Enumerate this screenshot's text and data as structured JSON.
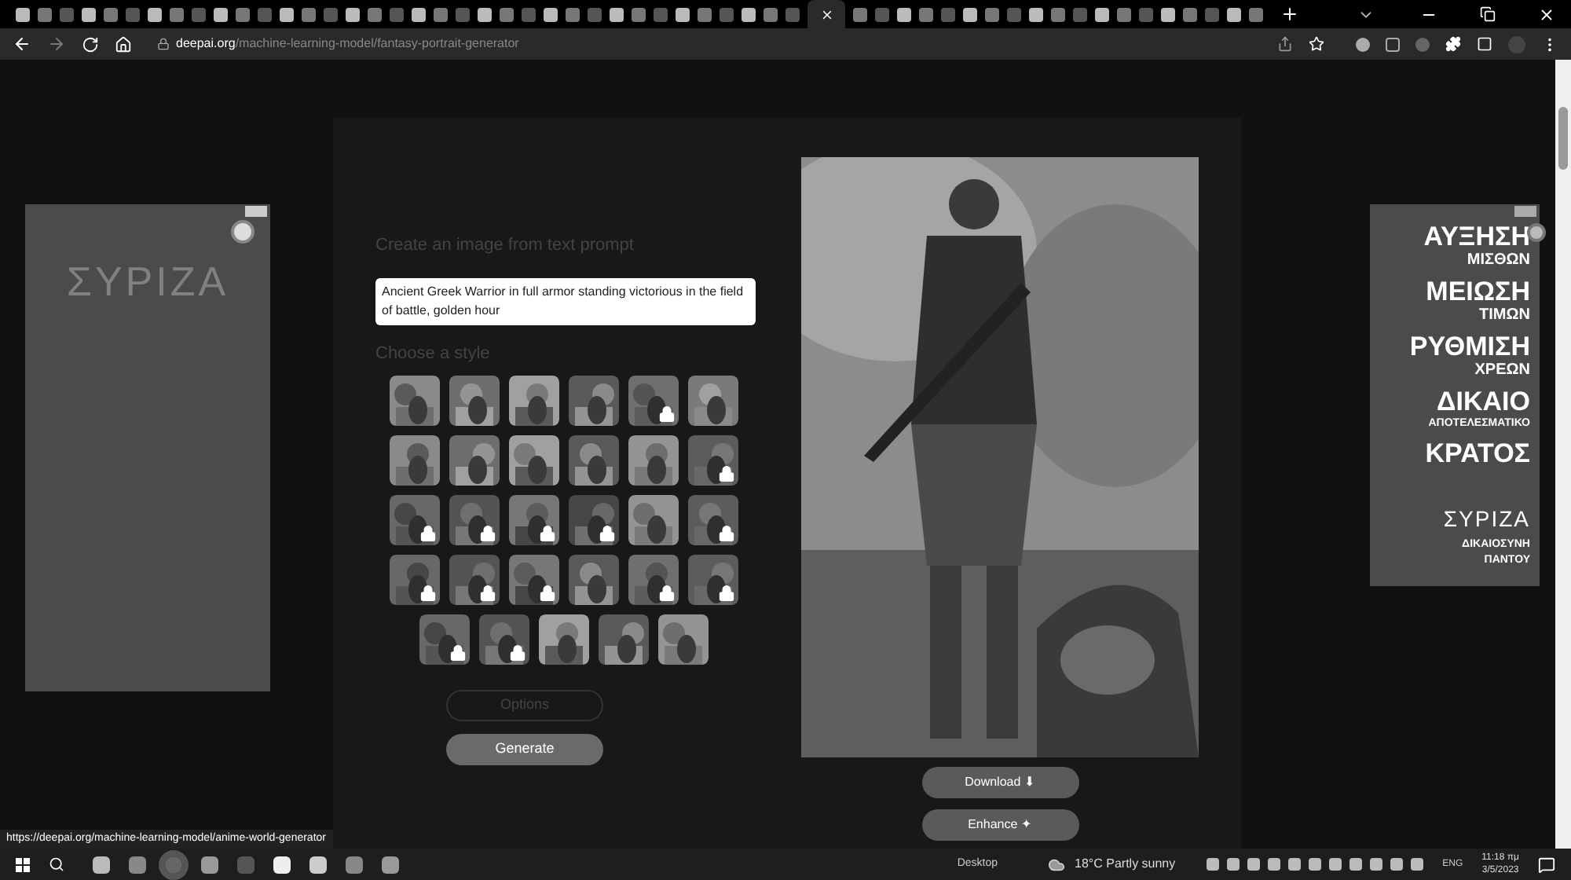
{
  "browser": {
    "url_domain": "deepai.org",
    "url_path": "/machine-learning-model/fantasy-portrait-generator"
  },
  "ads": {
    "left": {
      "logo": "ΣΥΡΙΖΑ"
    },
    "right": {
      "lines": [
        {
          "text": "ΑΥΞΗΣΗ",
          "kind": "big"
        },
        {
          "text": "ΜΙΣΘΩΝ",
          "kind": "small"
        },
        {
          "text": "ΜΕΙΩΣΗ",
          "kind": "big"
        },
        {
          "text": "ΤΙΜΩΝ",
          "kind": "small"
        },
        {
          "text": "ΡΥΘΜΙΣΗ",
          "kind": "big"
        },
        {
          "text": "ΧΡΕΩΝ",
          "kind": "small"
        },
        {
          "text": "ΔΙΚΑΙΟ",
          "kind": "big"
        },
        {
          "text": "ΑΠΟΤΕΛΕΣΜΑΤΙΚΟ",
          "kind": "tiny"
        },
        {
          "text": "ΚΡΑΤΟΣ",
          "kind": "big"
        }
      ],
      "logo": "ΣΥΡΙΖΑ",
      "slogan": [
        "ΔΙΚΑΙΟΣΥΝΗ",
        "ΠΑΝΤΟΥ"
      ]
    }
  },
  "generator": {
    "prompt_heading": "Create an image from text prompt",
    "prompt": "Ancient Greek Warrior in full armor standing victorious in the field of battle, golden hour",
    "style_heading": "Choose a style",
    "styles": [
      {
        "locked": false
      },
      {
        "locked": false
      },
      {
        "locked": false
      },
      {
        "locked": false
      },
      {
        "locked": true
      },
      {
        "locked": false
      },
      {
        "locked": false
      },
      {
        "locked": false
      },
      {
        "locked": false
      },
      {
        "locked": false
      },
      {
        "locked": false
      },
      {
        "locked": true
      },
      {
        "locked": true
      },
      {
        "locked": true
      },
      {
        "locked": true
      },
      {
        "locked": true
      },
      {
        "locked": false
      },
      {
        "locked": true
      },
      {
        "locked": true
      },
      {
        "locked": true
      },
      {
        "locked": true
      },
      {
        "locked": false
      },
      {
        "locked": true
      },
      {
        "locked": true
      },
      {
        "locked": true
      },
      {
        "locked": true
      },
      {
        "locked": false
      },
      {
        "locked": false
      },
      {
        "locked": false
      }
    ],
    "options_button": "Options",
    "generate_button": "Generate",
    "result_actions": [
      "Download ⬇",
      "Enhance ✦"
    ]
  },
  "status_url": "https://deepai.org/machine-learning-model/anime-world-generator",
  "taskbar": {
    "desktop_label": "Desktop",
    "weather": "18°C Partly sunny",
    "language": "ENG",
    "time": "11:18 πμ",
    "date": "3/5/2023"
  }
}
